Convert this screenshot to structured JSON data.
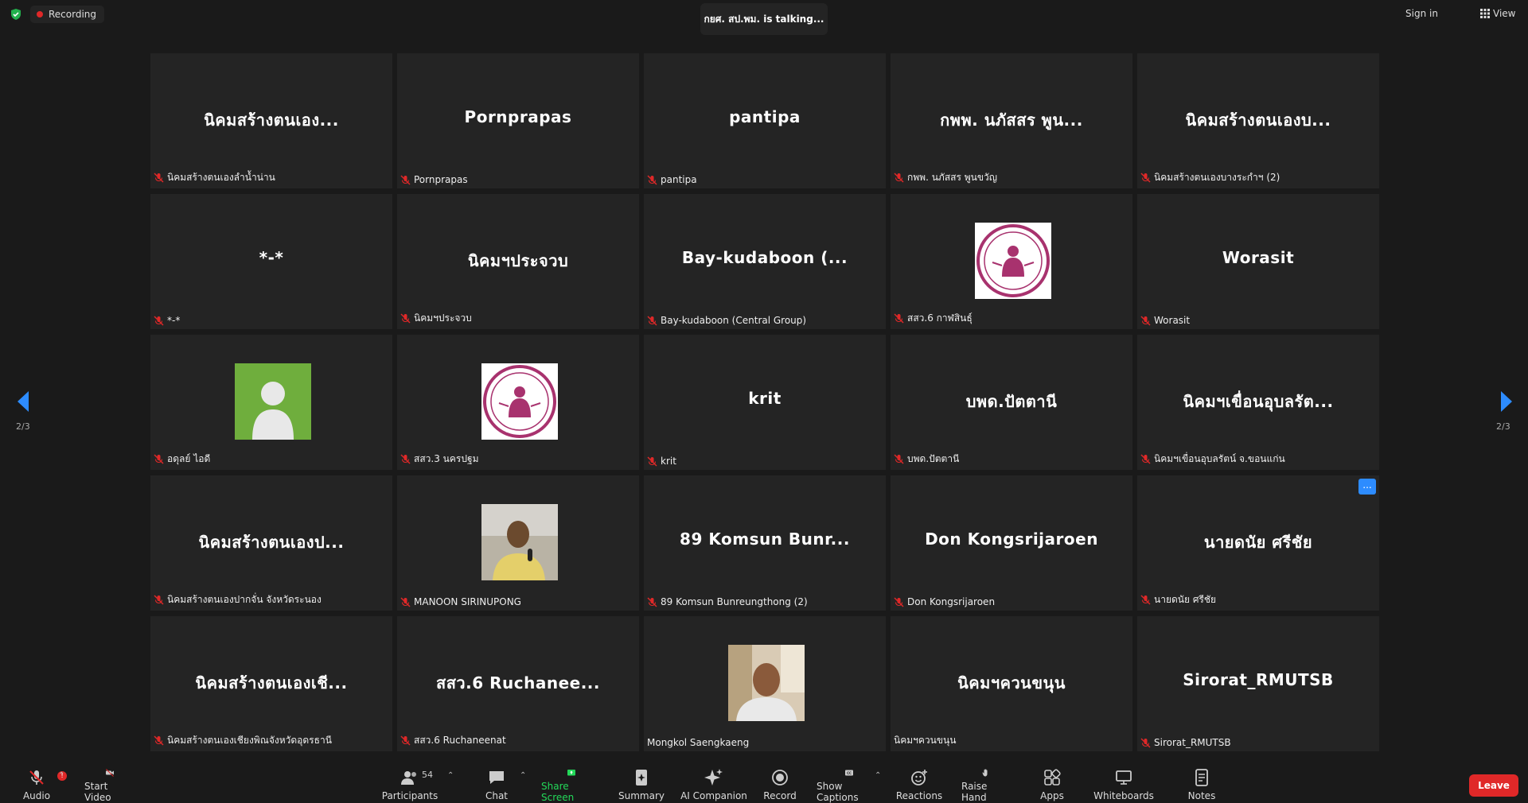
{
  "top": {
    "recording": "Recording",
    "talking": "กยศ. สป.พม. is  talking...",
    "sign_in": "Sign in",
    "view": "View"
  },
  "page_indicator": {
    "left": "2/3",
    "right": "2/3"
  },
  "tiles": [
    {
      "name": "นิคมสร้างตนเอง...",
      "label": "นิคมสร้างตนเองลำน้ำน่าน",
      "muted": true
    },
    {
      "name": "Pornprapas",
      "label": "Pornprapas",
      "muted": true
    },
    {
      "name": "pantipa",
      "label": "pantipa",
      "muted": true
    },
    {
      "name": "กพพ. นภัสสร พูน...",
      "label": "กพพ. นภัสสร พูนขวัญ",
      "muted": true
    },
    {
      "name": "นิคมสร้างตนเองบ...",
      "label": "นิคมสร้างตนเองบางระกำฯ (2)",
      "muted": true
    },
    {
      "name": "*-*",
      "label": "*-*",
      "muted": true
    },
    {
      "name": "นิคมฯประจวบ",
      "label": "นิคมฯประจวบ",
      "muted": true
    },
    {
      "name": "Bay-kudaboon  (...",
      "label": "Bay-kudaboon (Central Group)",
      "muted": true
    },
    {
      "name": "",
      "label": "สสว.6 กาฬสินธุ์",
      "muted": true,
      "avatar": "seal"
    },
    {
      "name": "Worasit",
      "label": "Worasit",
      "muted": true
    },
    {
      "name": "",
      "label": "อดุลย์ ไอดี",
      "muted": true,
      "avatar": "default-person"
    },
    {
      "name": "",
      "label": "สสว.3 นครปฐม",
      "muted": true,
      "avatar": "seal"
    },
    {
      "name": "krit",
      "label": "krit",
      "muted": true
    },
    {
      "name": "บพด.ปัตตานี",
      "label": "บพด.ปัตตานี",
      "muted": true
    },
    {
      "name": "นิคมฯเขื่อนอุบลรัต...",
      "label": "นิคมฯเขื่อนอุบลรัตน์ จ.ขอนแก่น",
      "muted": true
    },
    {
      "name": "นิคมสร้างตนเองป...",
      "label": "นิคมสร้างตนเองปากจั่น จังหวัดระนอง",
      "muted": true
    },
    {
      "name": "",
      "label": "MANOON SIRINUPONG",
      "muted": true,
      "avatar": "photo-man-microphone"
    },
    {
      "name": "89  Komsun  Bunr...",
      "label": "89 Komsun Bunreungthong (2)",
      "muted": true
    },
    {
      "name": "Don  Kongsrijaroen",
      "label": "Don Kongsrijaroen",
      "muted": true
    },
    {
      "name": "นายดนัย  ศรีชัย",
      "label": "นายดนัย ศรีชัย",
      "muted": true,
      "more": "..."
    },
    {
      "name": "นิคมสร้างตนเองเชี...",
      "label": "นิคมสร้างตนเองเชียงพิณจังหวัดอุดรธานี",
      "muted": true
    },
    {
      "name": "สสว.6  Ruchanee...",
      "label": "สสว.6 Ruchaneenat",
      "muted": true
    },
    {
      "name": "",
      "label": "Mongkol Saengkaeng",
      "muted": false,
      "avatar": "photo-man-video"
    },
    {
      "name": "นิคมฯควนขนุน",
      "label": "นิคมฯควนขนุน",
      "muted": false
    },
    {
      "name": "Sirorat_RMUTSB",
      "label": "Sirorat_RMUTSB",
      "muted": true
    }
  ],
  "toolbar": {
    "audio": "Audio",
    "audio_badge": "!",
    "start_video": "Start Video",
    "participants": "Participants",
    "participants_count": "54",
    "chat": "Chat",
    "share_screen": "Share Screen",
    "summary": "Summary",
    "ai_companion": "AI Companion",
    "record": "Record",
    "show_captions": "Show Captions",
    "reactions": "Reactions",
    "raise_hand": "Raise Hand",
    "apps": "Apps",
    "whiteboards": "Whiteboards",
    "notes": "Notes",
    "leave": "Leave"
  },
  "colors": {
    "accent": "#2d8cff",
    "share": "#23d959",
    "leave": "#e02828",
    "tile": "#242424",
    "bg": "#1a1a1a"
  }
}
